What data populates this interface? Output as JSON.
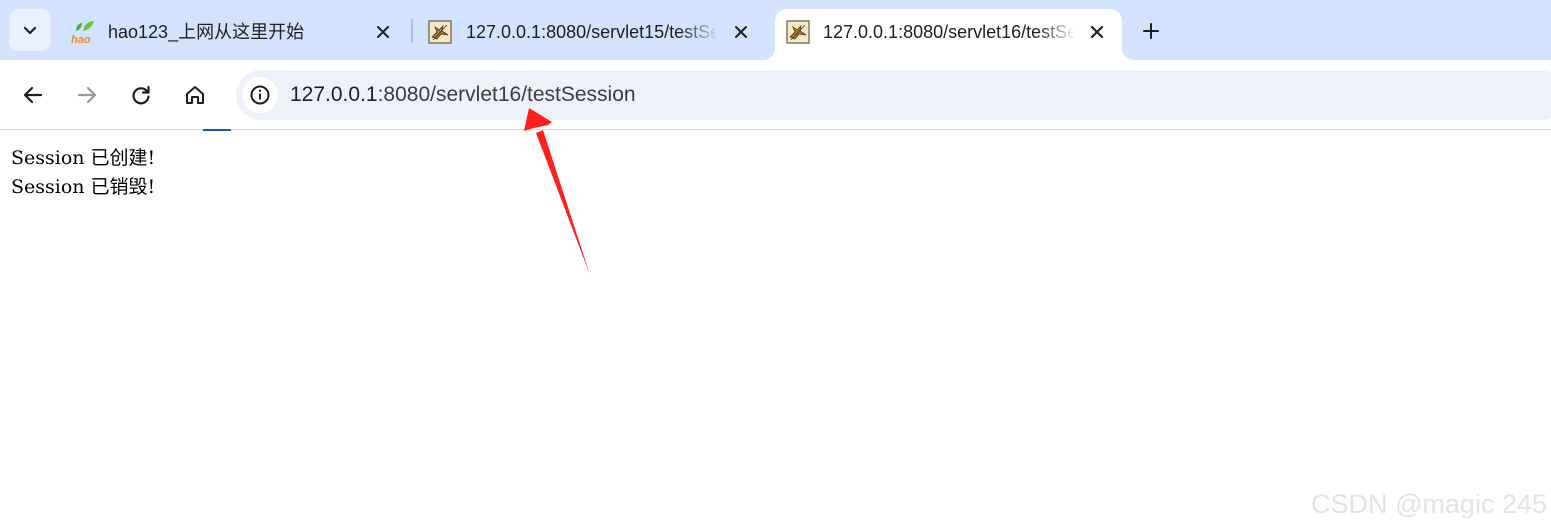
{
  "tabs": [
    {
      "title": "hao123_上网从这里开始",
      "favicon": "hao123-logo-icon",
      "favicon_text": "hao",
      "active": false
    },
    {
      "title": "127.0.0.1:8080/servlet15/testSession",
      "favicon": "tomcat-icon",
      "active": false
    },
    {
      "title": "127.0.0.1:8080/servlet16/testSession",
      "favicon": "tomcat-icon",
      "active": true
    }
  ],
  "toolbar": {
    "url_host": "127.0.0.1",
    "url_path": ":8080/servlet16/testSession"
  },
  "page": {
    "lines": [
      "Session 已创建!",
      "Session 已销毁!"
    ]
  },
  "annotation": {
    "color": "#ff1f1f"
  },
  "watermark": "CSDN @magic 245",
  "colors": {
    "tabstrip_bg": "#d3e3fd",
    "omnibox_bg": "#edf2fa",
    "arrow": "#ff1f1f"
  }
}
